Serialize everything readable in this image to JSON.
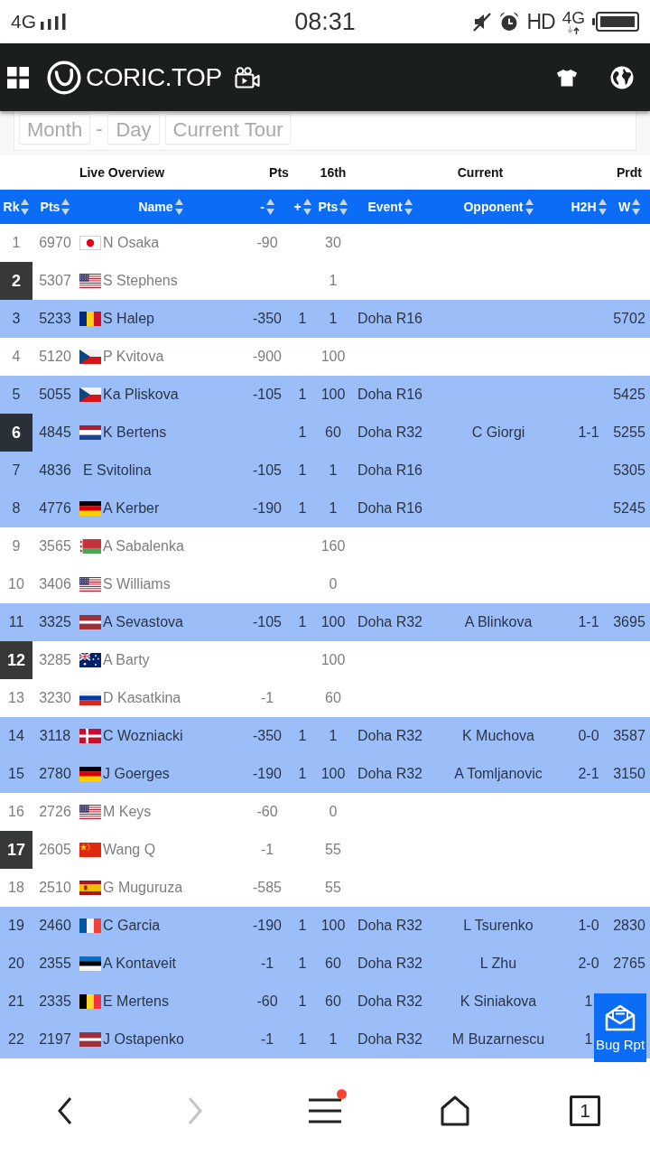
{
  "status_bar": {
    "network": "4G",
    "time": "08:31",
    "hd": "HD",
    "data": "4G"
  },
  "header": {
    "logo_text": "CORIC.TOP"
  },
  "filters": [
    {
      "kind": "dropdown",
      "value": "Month"
    },
    {
      "kind": "separator",
      "value": "-"
    },
    {
      "kind": "dropdown",
      "value": "Day"
    },
    {
      "kind": "dropdown",
      "value": "Current Tour"
    }
  ],
  "table": {
    "column_groups": [
      {
        "label": "Live Overview",
        "columns": [
          {
            "label": "Rk",
            "sortable": true
          },
          {
            "label": "Pts",
            "sortable": true
          },
          {
            "label": "Name",
            "sortable": true
          }
        ]
      },
      {
        "label": "Pts",
        "columns": [
          {
            "label": "-",
            "sortable": true
          },
          {
            "label": "+",
            "sortable": true
          }
        ]
      },
      {
        "label": "16th",
        "columns": [
          {
            "label": "Pts",
            "sortable": true
          }
        ]
      },
      {
        "label": "Current",
        "columns": [
          {
            "label": "Event",
            "sortable": true
          },
          {
            "label": "Opponent",
            "sortable": true
          },
          {
            "label": "H2H",
            "sortable": true
          }
        ]
      },
      {
        "label": "Prdt",
        "columns": [
          {
            "label": "W",
            "sortable": true
          }
        ]
      }
    ],
    "rows": [
      {
        "rank": "1",
        "rank_boxed": false,
        "highlighted": false,
        "pts": "6970",
        "flag": {
          "kind": "japan"
        },
        "name": "N Osaka",
        "pts_minus": "-90",
        "pts_16th": "30"
      },
      {
        "rank": "2",
        "rank_boxed": true,
        "highlighted": false,
        "pts": "5307",
        "flag": {
          "kind": "usa"
        },
        "name": "S Stephens",
        "pts_16th": "1"
      },
      {
        "rank": "3",
        "rank_boxed": false,
        "highlighted": true,
        "pts": "5233",
        "flag": {
          "kind": "romania"
        },
        "name": "S Halep",
        "pts_minus": "-350",
        "pts_plus": "1",
        "pts_16th": "1",
        "event": "Doha R16",
        "prdt_w": "5702"
      },
      {
        "rank": "4",
        "rank_boxed": false,
        "highlighted": false,
        "pts": "5120",
        "flag": {
          "kind": "czech"
        },
        "name": "P Kvitova",
        "pts_minus": "-900",
        "pts_16th": "100"
      },
      {
        "rank": "5",
        "rank_boxed": false,
        "highlighted": true,
        "pts": "5055",
        "flag": {
          "kind": "czech"
        },
        "name": "Ka Pliskova",
        "pts_minus": "-105",
        "pts_plus": "1",
        "pts_16th": "100",
        "event": "Doha R16",
        "prdt_w": "5425"
      },
      {
        "rank": "6",
        "rank_boxed": true,
        "highlighted": true,
        "pts": "4845",
        "flag": {
          "kind": "netherlands"
        },
        "name": "K Bertens",
        "pts_plus": "1",
        "pts_16th": "60",
        "event": "Doha R32",
        "opponent": "C Giorgi",
        "h2h": "1-1",
        "prdt_w": "5255"
      },
      {
        "rank": "7",
        "rank_boxed": false,
        "highlighted": true,
        "pts": "4836",
        "name": "E Svitolina",
        "pts_minus": "-105",
        "pts_plus": "1",
        "pts_16th": "1",
        "event": "Doha R16",
        "prdt_w": "5305"
      },
      {
        "rank": "8",
        "rank_boxed": false,
        "highlighted": true,
        "pts": "4776",
        "flag": {
          "kind": "germany"
        },
        "name": "A Kerber",
        "pts_minus": "-190",
        "pts_plus": "1",
        "pts_16th": "1",
        "event": "Doha R16",
        "prdt_w": "5245"
      },
      {
        "rank": "9",
        "rank_boxed": false,
        "highlighted": false,
        "pts": "3565",
        "flag": {
          "kind": "belarus"
        },
        "name": "A Sabalenka",
        "pts_16th": "160"
      },
      {
        "rank": "10",
        "rank_boxed": false,
        "highlighted": false,
        "pts": "3406",
        "flag": {
          "kind": "usa"
        },
        "name": "S Williams",
        "pts_16th": "0"
      },
      {
        "rank": "11",
        "rank_boxed": false,
        "highlighted": true,
        "pts": "3325",
        "flag": {
          "kind": "latvia"
        },
        "name": "A Sevastova",
        "pts_minus": "-105",
        "pts_plus": "1",
        "pts_16th": "100",
        "event": "Doha R32",
        "opponent": "A Blinkova",
        "h2h": "1-1",
        "prdt_w": "3695"
      },
      {
        "rank": "12",
        "rank_boxed": true,
        "highlighted": false,
        "pts": "3285",
        "flag": {
          "kind": "australia"
        },
        "name": "A Barty",
        "pts_16th": "100"
      },
      {
        "rank": "13",
        "rank_boxed": false,
        "highlighted": false,
        "pts": "3230",
        "flag": {
          "kind": "russia"
        },
        "name": "D Kasatkina",
        "pts_minus": "-1",
        "pts_16th": "60"
      },
      {
        "rank": "14",
        "rank_boxed": false,
        "highlighted": true,
        "pts": "3118",
        "flag": {
          "kind": "denmark"
        },
        "name": "C Wozniacki",
        "pts_minus": "-350",
        "pts_plus": "1",
        "pts_16th": "1",
        "event": "Doha R32",
        "opponent": "K Muchova",
        "h2h": "0-0",
        "prdt_w": "3587"
      },
      {
        "rank": "15",
        "rank_boxed": false,
        "highlighted": true,
        "pts": "2780",
        "flag": {
          "kind": "germany"
        },
        "name": "J Goerges",
        "pts_minus": "-190",
        "pts_plus": "1",
        "pts_16th": "100",
        "event": "Doha R32",
        "opponent": "A Tomljanovic",
        "h2h": "2-1",
        "prdt_w": "3150"
      },
      {
        "rank": "16",
        "rank_boxed": false,
        "highlighted": false,
        "pts": "2726",
        "flag": {
          "kind": "usa"
        },
        "name": "M Keys",
        "pts_minus": "-60",
        "pts_16th": "0"
      },
      {
        "rank": "17",
        "rank_boxed": true,
        "highlighted": false,
        "pts": "2605",
        "flag": {
          "kind": "china"
        },
        "name": "Wang Q",
        "pts_minus": "-1",
        "pts_16th": "55"
      },
      {
        "rank": "18",
        "rank_boxed": false,
        "highlighted": false,
        "pts": "2510",
        "flag": {
          "kind": "spain"
        },
        "name": "G Muguruza",
        "pts_minus": "-585",
        "pts_16th": "55"
      },
      {
        "rank": "19",
        "rank_boxed": false,
        "highlighted": true,
        "pts": "2460",
        "flag": {
          "kind": "france"
        },
        "name": "C Garcia",
        "pts_minus": "-190",
        "pts_plus": "1",
        "pts_16th": "100",
        "event": "Doha R32",
        "opponent": "L Tsurenko",
        "h2h": "1-0",
        "prdt_w": "2830"
      },
      {
        "rank": "20",
        "rank_boxed": false,
        "highlighted": true,
        "pts": "2355",
        "flag": {
          "kind": "estonia"
        },
        "name": "A Kontaveit",
        "pts_minus": "-1",
        "pts_plus": "1",
        "pts_16th": "60",
        "event": "Doha R32",
        "opponent": "L Zhu",
        "h2h": "2-0",
        "prdt_w": "2765"
      },
      {
        "rank": "21",
        "rank_boxed": false,
        "highlighted": true,
        "pts": "2335",
        "flag": {
          "kind": "belgium"
        },
        "name": "E Mertens",
        "pts_minus": "-60",
        "pts_plus": "1",
        "pts_16th": "60",
        "event": "Doha R32",
        "opponent": "K Siniakova",
        "h2h": "1"
      },
      {
        "rank": "22",
        "rank_boxed": false,
        "highlighted": true,
        "pts": "2197",
        "flag": {
          "kind": "latvia"
        },
        "name": "J Ostapenko",
        "pts_minus": "-1",
        "pts_plus": "1",
        "pts_16th": "1",
        "event": "Doha R32",
        "opponent": "M Buzarnescu",
        "h2h": "1"
      }
    ]
  },
  "bug_report": {
    "label": "Bug Rpt"
  },
  "browser_nav": {
    "forward_disabled": true,
    "menu_badge": true,
    "tab_count": "1"
  }
}
